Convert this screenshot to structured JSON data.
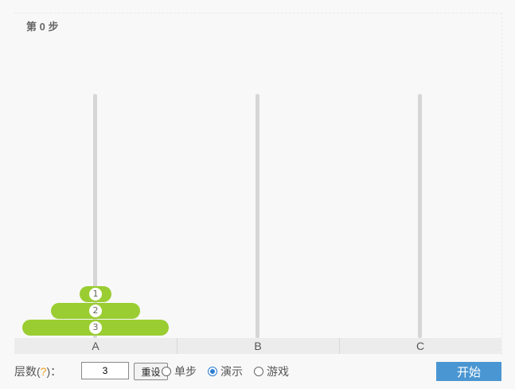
{
  "header": {
    "step_text": "第 0 步"
  },
  "pegs": [
    {
      "label": "A",
      "disks": [
        1,
        2,
        3
      ]
    },
    {
      "label": "B",
      "disks": []
    },
    {
      "label": "C",
      "disks": []
    }
  ],
  "disks": [
    {
      "number": "1",
      "size": 1
    },
    {
      "number": "2",
      "size": 2
    },
    {
      "number": "3",
      "size": 3
    }
  ],
  "controls": {
    "layers_label": "层数(",
    "help_mark": "?",
    "layers_label_end": ")：",
    "layers_value": "3",
    "reset_label": "重设",
    "modes": [
      {
        "label": "单步",
        "checked": false
      },
      {
        "label": "演示",
        "checked": true
      },
      {
        "label": "游戏",
        "checked": false
      }
    ],
    "start_label": "开始"
  },
  "colors": {
    "disk": "#9acd32",
    "rod": "#d6d6d6",
    "start_button": "#4a96d2",
    "help": "#f0a020"
  }
}
